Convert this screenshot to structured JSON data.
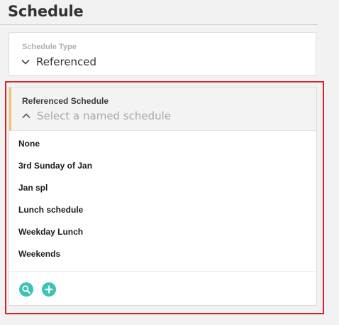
{
  "page": {
    "title": "Schedule"
  },
  "schedule_type": {
    "label": "Schedule Type",
    "value": "Referenced"
  },
  "referenced_schedule": {
    "label": "Referenced Schedule",
    "placeholder": "Select a named schedule",
    "options": [
      "None",
      "3rd Sunday of Jan",
      "Jan spl",
      "Lunch schedule",
      "Weekday Lunch",
      "Weekends"
    ]
  },
  "colors": {
    "accent_teal": "#3fc2b4",
    "focus_bar": "#f1c16b",
    "highlight_border": "#d9232b"
  },
  "icons": {
    "collapsed_chevron": "chevron-down-icon",
    "expanded_chevron": "chevron-up-icon",
    "search": "search-icon",
    "add": "plus-icon"
  }
}
